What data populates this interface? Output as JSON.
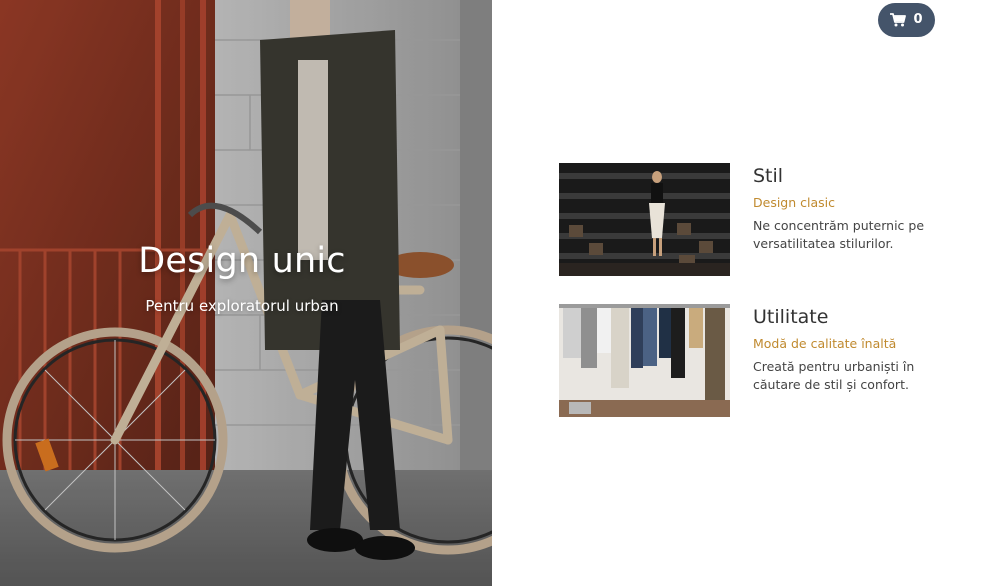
{
  "colors": {
    "accent": "#c08a2f",
    "cart_bg": "#44546a",
    "text_dark": "#333333",
    "text_body": "#444444"
  },
  "hero": {
    "title": "Design unic",
    "subtitle": "Pentru exploratorul urban"
  },
  "cart": {
    "icon": "shopping-cart-icon",
    "count": "0"
  },
  "features": [
    {
      "title": "Stil",
      "tagline": "Design clasic",
      "description": "Ne concentrăm puternic pe versatilitatea stilurilor."
    },
    {
      "title": "Utilitate",
      "tagline": "Modă de calitate înaltă",
      "description": "Creată pentru urbaniști în căutare de stil și confort."
    }
  ]
}
